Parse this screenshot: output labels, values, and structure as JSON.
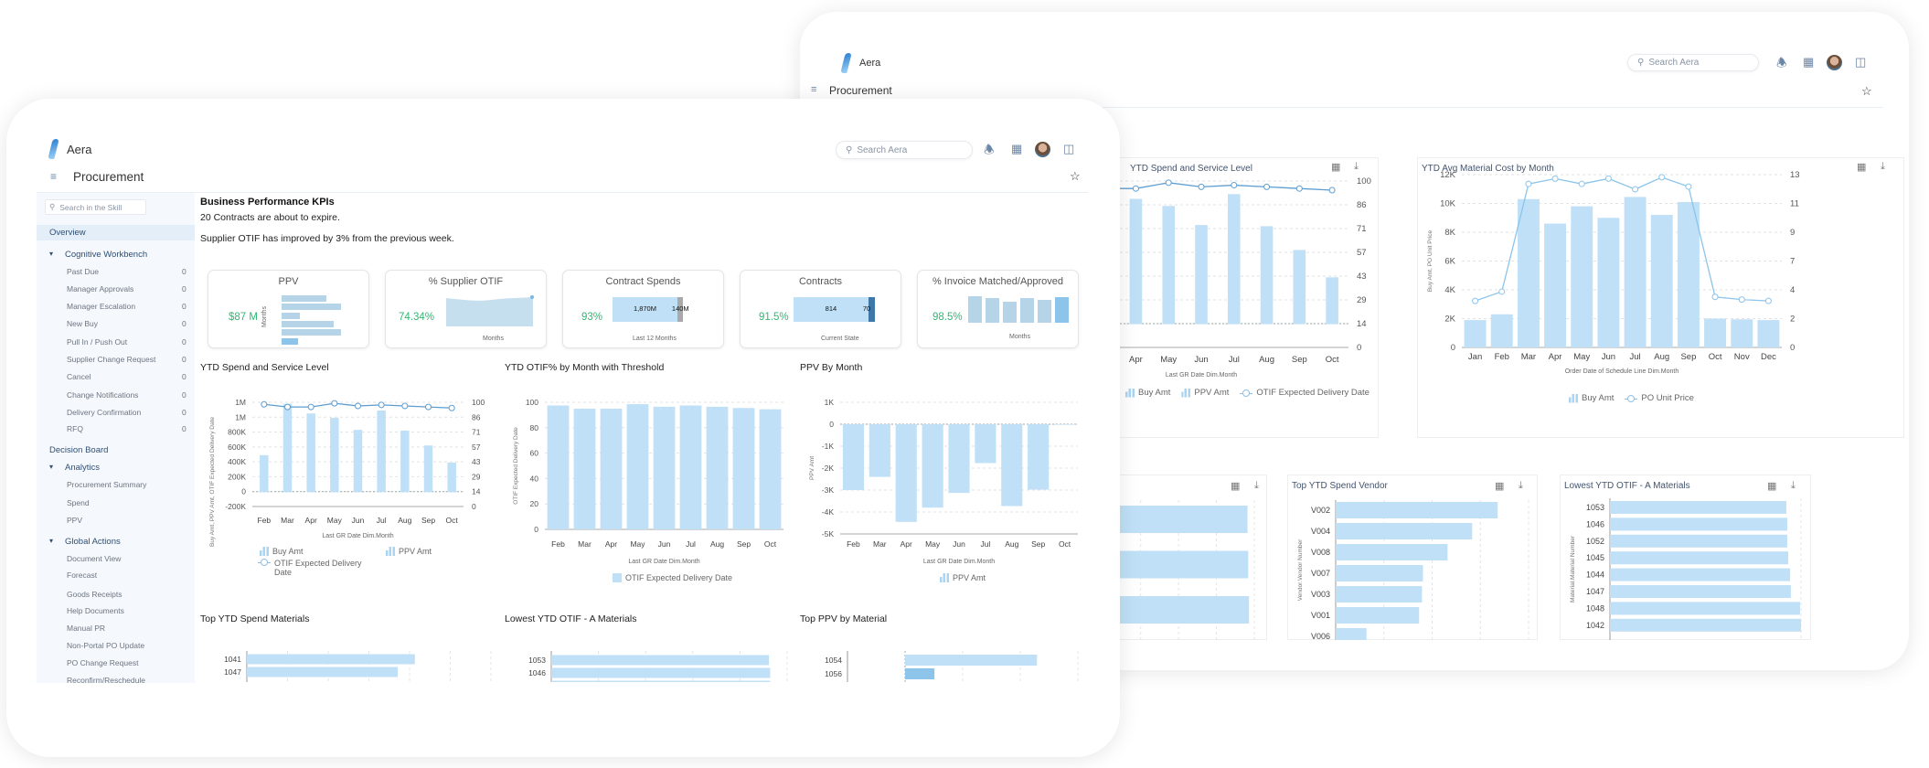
{
  "app": {
    "brand": "Aera",
    "page_title": "Procurement",
    "search_placeholder": "Search Aera"
  },
  "sidebar": {
    "search_placeholder": "Search in the Skill",
    "overview": "Overview",
    "sections": [
      {
        "label": "Cognitive Workbench",
        "items": [
          {
            "label": "Past Due",
            "count": "0"
          },
          {
            "label": "Manager Approvals",
            "count": "0"
          },
          {
            "label": "Manager Escalation",
            "count": "0"
          },
          {
            "label": "New Buy",
            "count": "0"
          },
          {
            "label": "Pull In / Push Out",
            "count": "0"
          },
          {
            "label": "Supplier Change Request",
            "count": "0"
          },
          {
            "label": "Cancel",
            "count": "0"
          },
          {
            "label": "Change Notifications",
            "count": "0"
          },
          {
            "label": "Delivery Confirmation",
            "count": "0"
          },
          {
            "label": "RFQ",
            "count": "0"
          }
        ]
      },
      {
        "label": "Decision Board"
      },
      {
        "label": "Analytics",
        "items": [
          {
            "label": "Procurement Summary"
          },
          {
            "label": "Spend"
          },
          {
            "label": "PPV"
          }
        ]
      },
      {
        "label": "Global Actions",
        "items": [
          {
            "label": "Document View"
          },
          {
            "label": "Forecast"
          },
          {
            "label": "Goods Receipts"
          },
          {
            "label": "Help Documents"
          },
          {
            "label": "Manual PR"
          },
          {
            "label": "Non-Portal PO Update"
          },
          {
            "label": "PO Change Request"
          },
          {
            "label": "Reconfirm/Reschedule"
          }
        ]
      }
    ]
  },
  "main": {
    "heading": "Business Performance KPIs",
    "messages": [
      "20 Contracts are about to expire.",
      "Supplier OTIF has improved by 3% from the previous week."
    ],
    "kpis": [
      {
        "title": "PPV",
        "value": "$87 M",
        "axis_label": "Months",
        "bars": [
          0.75,
          1.0,
          0.3,
          0.87,
          1.0,
          0.27
        ]
      },
      {
        "title": "% Supplier OTIF",
        "value": "74.34%",
        "axis_label": "Months"
      },
      {
        "title": "Contract Spends",
        "value": "93%",
        "segments": [
          {
            "label": "1,870M",
            "value": 1870
          },
          {
            "label": "140M",
            "value": 140
          }
        ],
        "caption": "Last 12 Months"
      },
      {
        "title": "Contracts",
        "value": "91.5%",
        "segments": [
          {
            "label": "814",
            "value": 814
          },
          {
            "label": "70",
            "value": 70
          }
        ],
        "caption": "Current State"
      },
      {
        "title": "% Invoice Matched/Approved",
        "value": "98.5%",
        "axis_label": "Months",
        "bars": [
          1.0,
          0.93,
          0.79,
          0.93,
          0.86,
          0.97
        ]
      }
    ]
  },
  "colors": {
    "bar": "#bfe0f7",
    "bar_dark": "#8cc4ea",
    "line": "#5e9dd0",
    "kpi_value": "#2eb872",
    "sidebar_header": "#2f4e73"
  },
  "chart_data": [
    {
      "id": "ytd_spend",
      "type": "bar+line",
      "title": "YTD Spend and Service Level",
      "xlabel": "Last GR Date Dim.Month",
      "ylabel": "Buy Amt, PPV Amt, OTIF Expected Delivery Date",
      "categories": [
        "Feb",
        "Mar",
        "Apr",
        "May",
        "Jun",
        "Jul",
        "Aug",
        "Sep",
        "Oct"
      ],
      "y_left": {
        "range": [
          -200000,
          1200000
        ],
        "ticks": [
          1200000,
          1000000,
          800000,
          600000,
          400000,
          200000,
          0,
          -200000
        ],
        "tick_labels": [
          "1M",
          "1M",
          "800K",
          "600K",
          "400K",
          "200K",
          "0",
          "-200K"
        ]
      },
      "y_right": {
        "range": [
          0,
          100
        ],
        "tick_labels": [
          "100",
          "86",
          "71",
          "57",
          "43",
          "29",
          "14",
          "0"
        ]
      },
      "series": [
        {
          "name": "Buy Amt",
          "type": "bar",
          "axis": "left",
          "values": [
            490000,
            1180000,
            1050000,
            990000,
            830000,
            1090000,
            820000,
            620000,
            390000
          ]
        },
        {
          "name": "PPV Amt",
          "type": "bar",
          "axis": "left",
          "values": [
            -3000,
            -2400,
            -4450,
            -3800,
            -3130,
            -1770,
            -3730,
            -2980,
            0
          ]
        },
        {
          "name": "OTIF Expected Delivery Date",
          "type": "line",
          "axis": "right",
          "values": [
            98,
            95.5,
            95.5,
            99,
            96.5,
            97.5,
            96.5,
            95.5,
            94.5
          ]
        }
      ],
      "legend": [
        "Buy Amt",
        "PPV Amt",
        "OTIF Expected Delivery Date"
      ],
      "grid": true
    },
    {
      "id": "otif_month",
      "type": "bar",
      "title": "YTD OTIF% by Month with Threshold",
      "xlabel": "Last GR Date Dim.Month",
      "ylabel": "OTIF Expected Delivery Date",
      "categories": [
        "Feb",
        "Mar",
        "Apr",
        "May",
        "Jun",
        "Jul",
        "Aug",
        "Sep",
        "Oct"
      ],
      "y_left": {
        "range": [
          0,
          100
        ],
        "ticks": [
          100,
          80,
          60,
          40,
          20,
          0
        ],
        "tick_labels": [
          "100",
          "80",
          "60",
          "40",
          "20",
          "0"
        ]
      },
      "series": [
        {
          "name": "OTIF Expected Delivery Date",
          "type": "bar",
          "values": [
            97.5,
            95,
            95,
            98.5,
            96.5,
            97.5,
            96.5,
            95.5,
            94.5
          ]
        }
      ],
      "legend": [
        "OTIF Expected Delivery Date"
      ],
      "grid": true
    },
    {
      "id": "ppv_month",
      "type": "bar",
      "title": "PPV By Month",
      "xlabel": "Last GR Date Dim.Month",
      "ylabel": "PPV Amt",
      "categories": [
        "Feb",
        "Mar",
        "Apr",
        "May",
        "Jun",
        "Jul",
        "Aug",
        "Sep",
        "Oct"
      ],
      "y_left": {
        "range": [
          -5000,
          1000
        ],
        "ticks": [
          1000,
          0,
          -1000,
          -2000,
          -3000,
          -4000,
          -5000
        ],
        "tick_labels": [
          "1K",
          "0",
          "-1K",
          "-2K",
          "-3K",
          "-4K",
          "-5K"
        ]
      },
      "series": [
        {
          "name": "PPV Amt",
          "type": "bar",
          "values": [
            -3000,
            -2400,
            -4450,
            -3800,
            -3130,
            -1770,
            -3730,
            -2980,
            0
          ]
        }
      ],
      "legend": [
        "PPV Amt"
      ],
      "grid": true
    },
    {
      "id": "avg_cost",
      "type": "bar+line",
      "title": "YTD Avg Material Cost by Month",
      "xlabel": "Order Date of Schedule Line Dim.Month",
      "ylabel": "Buy Amt, PO Unit Price",
      "categories": [
        "Jan",
        "Feb",
        "Mar",
        "Apr",
        "May",
        "Jun",
        "Jul",
        "Aug",
        "Sep",
        "Oct",
        "Nov",
        "Dec"
      ],
      "y_left": {
        "range": [
          0,
          12000
        ],
        "ticks": [
          12000,
          10000,
          8000,
          6000,
          4000,
          2000,
          0
        ],
        "tick_labels": [
          "12K",
          "10K",
          "8K",
          "6K",
          "4K",
          "2K",
          "0"
        ]
      },
      "y_right": {
        "range": [
          0,
          13
        ],
        "tick_labels": [
          "13",
          "11",
          "9",
          "7",
          "4",
          "2",
          "0"
        ]
      },
      "series": [
        {
          "name": "Buy Amt",
          "type": "bar",
          "axis": "left",
          "values": [
            1900,
            2300,
            10300,
            8600,
            9800,
            9000,
            10450,
            9200,
            10100,
            2000,
            1950,
            1900
          ]
        },
        {
          "name": "PO Unit Price",
          "type": "line",
          "axis": "right",
          "values": [
            3.5,
            4.2,
            12.3,
            12.7,
            12.3,
            12.7,
            11.9,
            12.8,
            12.1,
            3.8,
            3.6,
            3.5
          ]
        }
      ],
      "legend": [
        "Buy Amt",
        "PO Unit Price"
      ],
      "grid": true
    },
    {
      "id": "top_spend_materials",
      "type": "hbar",
      "title": "Top YTD Spend Materials",
      "categories": [
        "1041",
        "1047"
      ],
      "values": [
        4.13,
        3.71
      ],
      "xlim": [
        0,
        6
      ]
    },
    {
      "id": "lowest_otif",
      "type": "hbar",
      "title": "Lowest YTD OTIF - A Materials",
      "ylabel": "Material.Material Number",
      "categories": [
        "1053",
        "1046",
        "1052",
        "1045",
        "1044",
        "1047",
        "1048",
        "1042"
      ],
      "values": [
        92.3,
        92.8,
        92.8,
        93.3,
        94.3,
        94.7,
        99.5,
        100
      ],
      "xlim": [
        0,
        100
      ]
    },
    {
      "id": "top_ppv_material",
      "type": "hbar",
      "title": "Top PPV by Material",
      "categories": [
        "1054",
        "1056"
      ],
      "values": [
        2.29,
        0.51
      ],
      "xlim": [
        -1,
        3
      ]
    },
    {
      "id": "top_spend_vendor",
      "type": "hbar",
      "title": "Top YTD Spend Vendor",
      "ylabel": "Vendor.Vendor Number",
      "categories": [
        "V002",
        "V004",
        "V008",
        "V007",
        "V003",
        "V001",
        "V006"
      ],
      "values": [
        3.36,
        2.83,
        2.32,
        1.81,
        1.79,
        1.73,
        0.64
      ],
      "xlim": [
        0,
        4
      ]
    },
    {
      "id": "back_partial",
      "type": "hbar",
      "title": "",
      "categories": [
        "",
        "",
        "",
        ""
      ],
      "values": [
        6.82,
        6.84,
        6.86,
        6.88
      ],
      "xlim": [
        0,
        7
      ]
    }
  ]
}
